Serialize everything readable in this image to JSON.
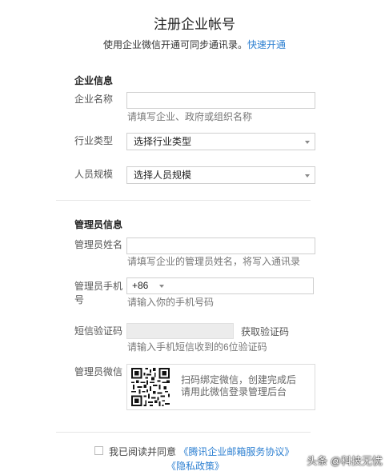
{
  "header": {
    "title": "注册企业帐号",
    "subtitle": "使用企业微信开通可同步通讯录。",
    "quick_link": "快速开通"
  },
  "company_section": {
    "title": "企业信息",
    "name_label": "企业名称",
    "name_value": "",
    "name_hint": "请填写企业、政府或组织名称",
    "industry_label": "行业类型",
    "industry_value": "选择行业类型",
    "size_label": "人员规模",
    "size_value": "选择人员规模"
  },
  "admin_section": {
    "title": "管理员信息",
    "name_label": "管理员姓名",
    "name_value": "",
    "name_hint": "请填写企业的管理员姓名，将写入通讯录",
    "phone_label_line1": "管理员手机",
    "phone_label_line2": "号",
    "country_code": "+86",
    "phone_value": "",
    "phone_hint": "请输入你的手机号码",
    "sms_label": "短信验证码",
    "sms_value": "",
    "sms_button": "获取验证码",
    "sms_hint": "请输入手机短信收到的6位验证码",
    "wechat_label": "管理员微信",
    "wechat_text": "扫码绑定微信，创建完成后请用此微信登录管理后台"
  },
  "footer": {
    "agree_prefix": "我已阅读并同意",
    "agreement_link": "《腾讯企业邮箱服务协议》",
    "privacy_link": "《隐私政策》",
    "watermark": "头条 @科技无忧"
  }
}
